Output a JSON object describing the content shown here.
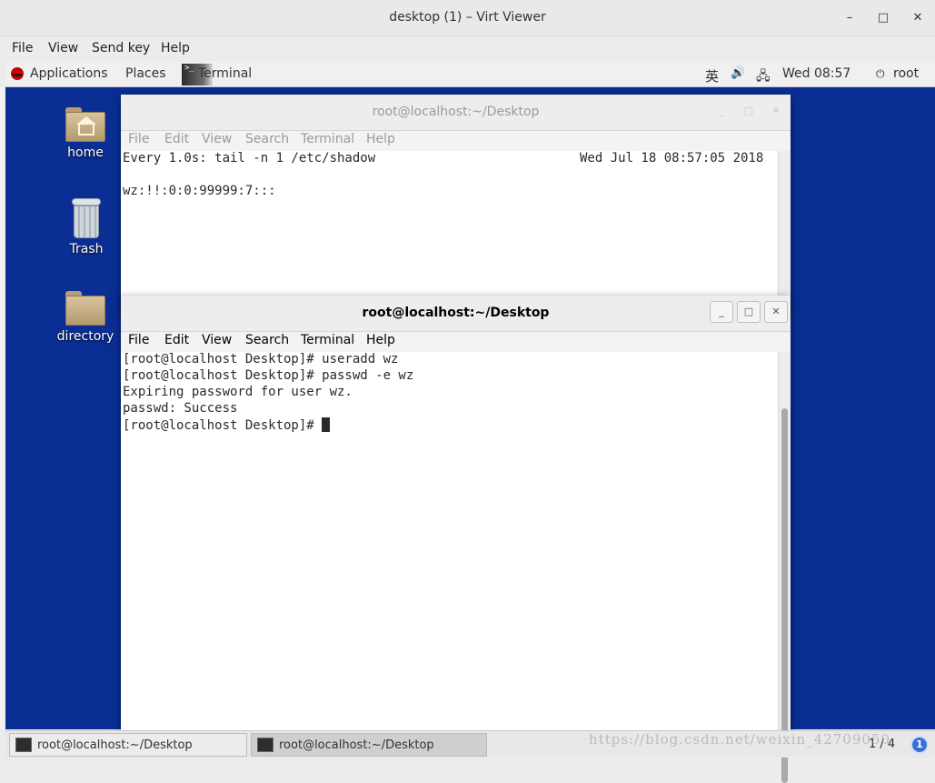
{
  "viewer": {
    "title": "desktop (1) – Virt Viewer",
    "minimize_glyph": "–",
    "maximize_glyph": "□",
    "close_glyph": "✕",
    "menu": [
      "File",
      "View",
      "Send key",
      "Help"
    ]
  },
  "panel": {
    "applications": "Applications",
    "places": "Places",
    "terminal_tab": "Terminal",
    "ime": "英",
    "volume_glyph": "🔊",
    "network_glyph": "🖧",
    "clock": "Wed 08:57",
    "user_glyph": "⏻",
    "user": "root"
  },
  "desktop_icons": {
    "home": "home",
    "trash": "Trash",
    "directory": "directory"
  },
  "term_back": {
    "title": "root@localhost:~/Desktop",
    "menu": [
      "File",
      "Edit",
      "View",
      "Search",
      "Terminal",
      "Help"
    ],
    "header_left": "Every 1.0s: tail -n 1 /etc/shadow",
    "header_right": "Wed Jul 18 08:57:05 2018",
    "line": "wz:!!:0:0:99999:7:::"
  },
  "term_front": {
    "title": "root@localhost:~/Desktop",
    "menu": [
      "File",
      "Edit",
      "View",
      "Search",
      "Terminal",
      "Help"
    ],
    "lines": [
      "[root@localhost Desktop]# useradd wz",
      "[root@localhost Desktop]# passwd -e wz",
      "Expiring password for user wz.",
      "passwd: Success",
      "[root@localhost Desktop]# "
    ]
  },
  "taskbar": {
    "tasks": [
      "root@localhost:~/Desktop",
      "root@localhost:~/Desktop"
    ],
    "workspace": "1 / 4",
    "badge": "1"
  },
  "watermark": "https://blog.csdn.net/weixin_42709050"
}
